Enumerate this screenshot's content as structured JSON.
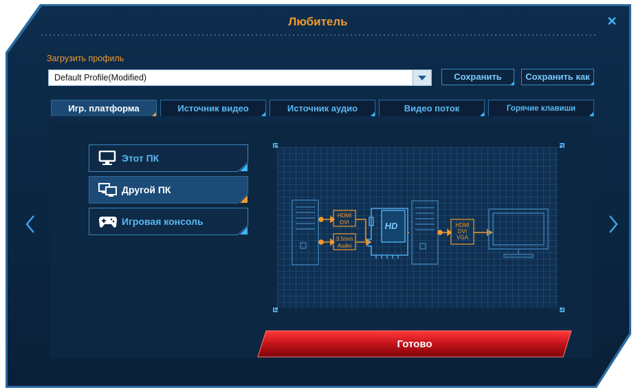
{
  "window": {
    "title": "Любитель"
  },
  "profile": {
    "label": "Загрузить профиль",
    "selected": "Default Profile(Modified)",
    "save_label": "Сохранить",
    "save_as_label": "Сохранить как"
  },
  "tabs": [
    {
      "label": "Игр. платформа",
      "active": true
    },
    {
      "label": "Источник видео",
      "active": false
    },
    {
      "label": "Источник аудио",
      "active": false
    },
    {
      "label": "Видео поток",
      "active": false
    },
    {
      "label": "Горячие клавиши",
      "active": false
    }
  ],
  "sources": [
    {
      "label": "Этот ПК",
      "icon": "monitor-icon",
      "selected": false
    },
    {
      "label": "Другой ПК",
      "icon": "dual-monitor-icon",
      "selected": true
    },
    {
      "label": "Игровая консоль",
      "icon": "gamepad-icon",
      "selected": false
    }
  ],
  "diagram": {
    "input_video": [
      "HDMI",
      "DVI"
    ],
    "input_audio": [
      "3.5mm",
      "Audio"
    ],
    "output": [
      "HDMI",
      "DVI",
      "VGA"
    ],
    "card_text": "HD"
  },
  "footer": {
    "done_label": "Готово"
  },
  "colors": {
    "accent": "#f39a2c",
    "link": "#59b8f5",
    "done_red": "#c4121a"
  }
}
